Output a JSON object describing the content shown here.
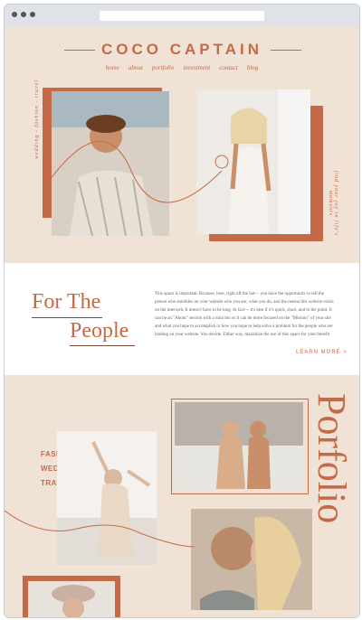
{
  "window": {},
  "header": {
    "brand": "COCO CAPTAIN",
    "nav": [
      "home",
      "about",
      "portfolio",
      "investment",
      "contact",
      "blog"
    ]
  },
  "hero": {
    "left_tagline": "wedding - fashion - travel",
    "right_tagline": "find your joy in life's moments"
  },
  "intro": {
    "title_line1": "For The",
    "title_line2": "People",
    "body": "This space is important. Because, here, right off the bat— you have the opportunity to tell the person who stumbles on your website who you are; what you do, and the reason this website exists on the interweb. It doesn't have to be long. In fact— it's best if it's quick, short, and to the point. It can be an \"About\" section with a mini bio or it can be more focused on the \"Mission\" of your site and what you hope to accomplish or how you hope to help solve a problem for the people who are landing on your website. You decide. Either way, maximize the use of this space for your benefit",
    "learn_more": "LEARN MORE >"
  },
  "portfolio": {
    "title": "Porfolio",
    "categories": [
      "FASHION",
      "WEDDINGS",
      "TRAVEL"
    ]
  },
  "colors": {
    "accent": "#c56a48",
    "background": "#f1e2d6",
    "white": "#ffffff"
  }
}
